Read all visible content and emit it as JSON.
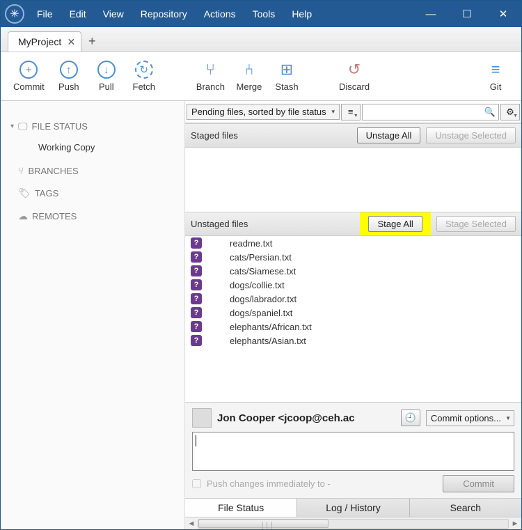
{
  "menu": [
    "File",
    "Edit",
    "View",
    "Repository",
    "Actions",
    "Tools",
    "Help"
  ],
  "tab": {
    "name": "MyProject"
  },
  "toolbar": [
    {
      "id": "commit",
      "label": "Commit",
      "icon": "+"
    },
    {
      "id": "push",
      "label": "Push",
      "icon": "↑"
    },
    {
      "id": "pull",
      "label": "Pull",
      "icon": "↓"
    },
    {
      "id": "fetch",
      "label": "Fetch",
      "icon": "↻",
      "dashed": true
    },
    {
      "id": "branch",
      "label": "Branch",
      "icon": "⑂",
      "noborder": true
    },
    {
      "id": "merge",
      "label": "Merge",
      "icon": "⑃",
      "noborder": true
    },
    {
      "id": "stash",
      "label": "Stash",
      "icon": "⊞",
      "noborder": true
    },
    {
      "id": "discard",
      "label": "Discard",
      "icon": "↺",
      "noborder": true
    },
    {
      "id": "git",
      "label": "Git",
      "icon": "≡",
      "noborder": true
    }
  ],
  "sidebar": {
    "filestatus": {
      "label": "FILE STATUS",
      "sub": "Working Copy"
    },
    "branches": {
      "label": "BRANCHES"
    },
    "tags": {
      "label": "TAGS"
    },
    "remotes": {
      "label": "REMOTES"
    }
  },
  "filter": {
    "mode": "Pending files, sorted by file status"
  },
  "staged": {
    "title": "Staged files",
    "unstage_all": "Unstage All",
    "unstage_sel": "Unstage Selected"
  },
  "unstaged": {
    "title": "Unstaged files",
    "stage_all": "Stage All",
    "stage_sel": "Stage Selected",
    "files": [
      "readme.txt",
      "cats/Persian.txt",
      "cats/Siamese.txt",
      "dogs/collie.txt",
      "dogs/labrador.txt",
      "dogs/spaniel.txt",
      "elephants/African.txt",
      "elephants/Asian.txt"
    ]
  },
  "commit": {
    "author": "Jon Cooper <jcoop@ceh.ac",
    "options": "Commit options...",
    "push_label": "Push changes immediately to -",
    "commit_btn": "Commit"
  },
  "bottom_tabs": [
    "File Status",
    "Log / History",
    "Search"
  ]
}
